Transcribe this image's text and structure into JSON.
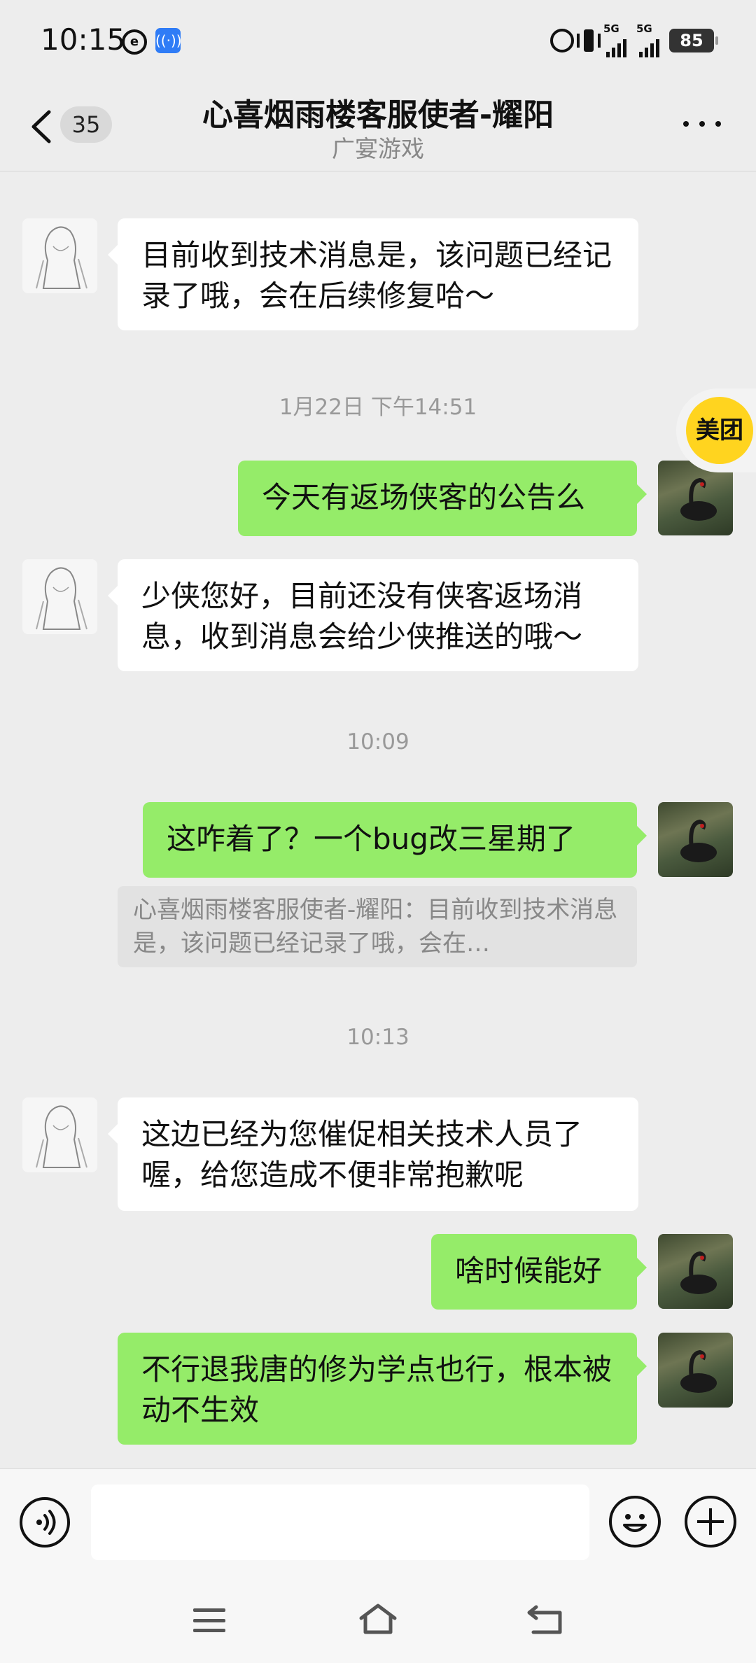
{
  "status_bar": {
    "time": "10:15",
    "signal1_label": "5G",
    "signal2_label": "5G",
    "battery": "85",
    "icons": [
      "sim-icon",
      "hotspot-icon",
      "alarm-icon",
      "vibrate-icon",
      "signal-icon",
      "battery-icon"
    ]
  },
  "header": {
    "title": "心喜烟雨楼客服使者-耀阳",
    "subtitle": "广宴游戏",
    "unread_count": "35"
  },
  "messages": [
    {
      "side": "left",
      "text": "目前收到技术消息是，该问题已经记录了哦，会在后续修复哈～"
    },
    {
      "type": "time",
      "text": "1月22日 下午14:51"
    },
    {
      "side": "right",
      "text": "今天有返场侠客的公告么"
    },
    {
      "side": "left",
      "text": "少侠您好，目前还没有侠客返场消息，收到消息会给少侠推送的哦～"
    },
    {
      "type": "time",
      "text": "10:09"
    },
    {
      "side": "right",
      "text": "这咋着了？一个bug改三星期了"
    },
    {
      "type": "quote",
      "text": "心喜烟雨楼客服使者-耀阳：目前收到技术消息是，该问题已经记录了哦，会在…"
    },
    {
      "type": "time",
      "text": "10:13"
    },
    {
      "side": "left",
      "text": "这边已经为您催促相关技术人员了喔，给您造成不便非常抱歉呢"
    },
    {
      "side": "right",
      "text": "啥时候能好"
    },
    {
      "side": "right",
      "text": "不行退我唐的修为学点也行，根本被动不生效"
    }
  ],
  "floating_widget": {
    "label": "美团"
  },
  "colors": {
    "background": "#ededed",
    "my_bubble": "#95ec69",
    "their_bubble": "#ffffff",
    "badge": "#ffd41f"
  }
}
